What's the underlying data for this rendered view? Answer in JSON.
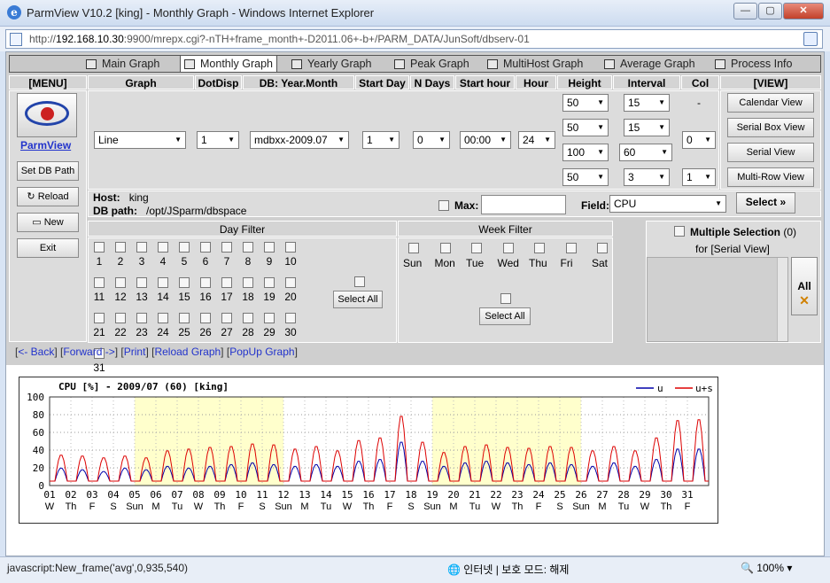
{
  "window": {
    "title": "ParmView V10.2 [king] - Monthly Graph - Windows Internet Explorer",
    "ie_icon": "e"
  },
  "address": {
    "scheme": "http://",
    "host": "192.168.10.30",
    "rest": ":9900/mrepx.cgi?-nTH+frame_month+-D2011.06+-b+/PARM_DATA/JunSoft/dbserv-01"
  },
  "tabs": [
    "Main Graph",
    "Monthly Graph",
    "Yearly Graph",
    "Peak Graph",
    "MultiHost Graph",
    "Average Graph",
    "Process Info"
  ],
  "headers": {
    "menu": "[MENU]",
    "graph": "Graph",
    "dotdisp": "DotDisp",
    "db": "DB: Year.Month",
    "startday": "Start Day",
    "ndays": "N Days",
    "starthour": "Start hour",
    "hour": "Hour",
    "height": "Height",
    "interval": "Interval",
    "col": "Col",
    "view": "[VIEW]"
  },
  "menu": {
    "logo_text": "ParmView",
    "set_db_path": "Set DB Path",
    "reload": "Reload",
    "new": "New",
    "exit": "Exit"
  },
  "values": {
    "graph": "Line",
    "dotdisp": "1",
    "db": "mdbxx-2009.07",
    "startday": "1",
    "ndays": "0",
    "starthour": "00:00",
    "hour": "24",
    "height": [
      "50",
      "50",
      "100",
      "50"
    ],
    "interval": [
      "15",
      "15",
      "60",
      "3"
    ],
    "col": [
      "-",
      "0",
      "1"
    ]
  },
  "view": [
    "Calendar View",
    "Serial Box View",
    "Serial View",
    "Multi-Row View"
  ],
  "host": {
    "host_label": "Host:",
    "host": "king",
    "db_label": "DB path:",
    "db": "/opt/JSparm/dbspace"
  },
  "max_label": "Max:",
  "field": {
    "label": "Field:",
    "value": "CPU"
  },
  "select_label": "Select",
  "day_filter": {
    "title": "Day Filter",
    "select_all": "Select All"
  },
  "week_filter": {
    "title": "Week Filter",
    "days": [
      "Sun",
      "Mon",
      "Tue",
      "Wed",
      "Thu",
      "Fri",
      "Sat"
    ],
    "select_all": "Select All"
  },
  "multi": {
    "label": "Multiple Selection",
    "count": "(0)",
    "for": "for [Serial View]",
    "all": "All"
  },
  "links": {
    "back": "<- Back",
    "forward": "Forward ->",
    "print": "Print",
    "reload": "Reload Graph",
    "popup": "PopUp Graph"
  },
  "status": {
    "text": "javascript:New_frame('avg',0,935,540)",
    "zone": "인터넷 | 보호 모드: 해제",
    "zoom": "100%"
  },
  "chart_data": {
    "type": "line",
    "title": "CPU [%] - 2009/07 (60) [king]",
    "ylim": [
      0,
      100
    ],
    "yticks": [
      0,
      20,
      40,
      60,
      80,
      100
    ],
    "days": [
      "01",
      "02",
      "03",
      "04",
      "05",
      "06",
      "07",
      "08",
      "09",
      "10",
      "11",
      "12",
      "13",
      "14",
      "15",
      "16",
      "17",
      "18",
      "19",
      "20",
      "21",
      "22",
      "23",
      "24",
      "25",
      "26",
      "27",
      "28",
      "29",
      "30",
      "31"
    ],
    "weekdays": [
      "W",
      "Th",
      "F",
      "S",
      "Sun",
      "M",
      "Tu",
      "W",
      "Th",
      "F",
      "S",
      "Sun",
      "M",
      "Tu",
      "W",
      "Th",
      "F",
      "S",
      "Sun",
      "M",
      "Tu",
      "W",
      "Th",
      "F",
      "S",
      "Sun",
      "M",
      "Tu",
      "W",
      "Th",
      "F"
    ],
    "series": [
      {
        "name": "u",
        "color": "#0000aa",
        "daily_peak": [
          20,
          18,
          16,
          20,
          18,
          22,
          20,
          22,
          24,
          26,
          24,
          22,
          24,
          22,
          28,
          30,
          50,
          28,
          22,
          26,
          28,
          26,
          24,
          26,
          24,
          22,
          26,
          22,
          30,
          42,
          42
        ]
      },
      {
        "name": "u+s",
        "color": "#dd0000",
        "daily_peak": [
          35,
          34,
          32,
          34,
          32,
          40,
          42,
          44,
          45,
          48,
          47,
          42,
          45,
          40,
          52,
          55,
          80,
          50,
          38,
          45,
          47,
          44,
          43,
          45,
          44,
          40,
          45,
          40,
          55,
          75,
          76
        ]
      }
    ],
    "highlight_weeks": [
      [
        5,
        11
      ],
      [
        19,
        25
      ]
    ],
    "highlight_color": "#ffffcc"
  }
}
